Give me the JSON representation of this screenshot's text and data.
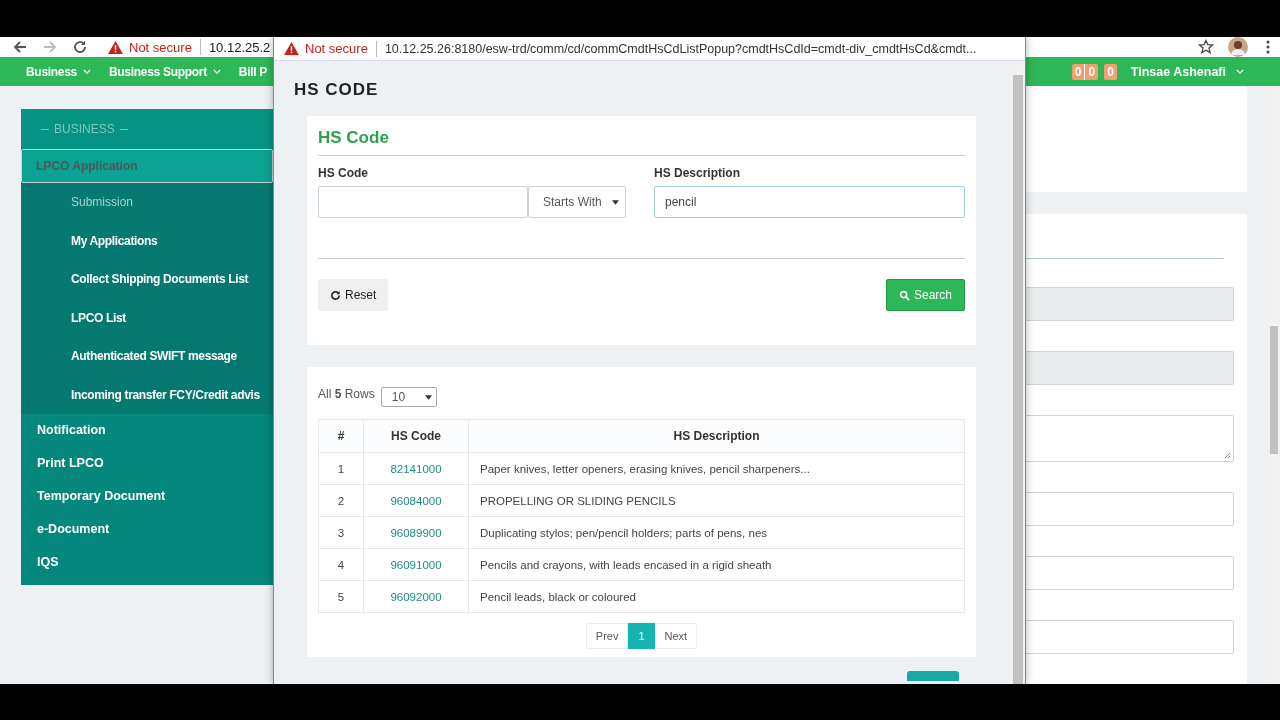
{
  "browser": {
    "security": "Not secure",
    "url": "10.12.25.2"
  },
  "nav": {
    "items": [
      {
        "label": "Business",
        "dropdown": true
      },
      {
        "label": "Business Support",
        "dropdown": true
      },
      {
        "label": "Bill P",
        "dropdown": false
      }
    ],
    "badge_groups": [
      {
        "counts": [
          "0",
          "0"
        ]
      },
      {
        "counts": [
          "0"
        ]
      }
    ],
    "user": "Tinsae Ashenafi"
  },
  "sidebar": {
    "section": "BUSINESS",
    "items": [
      {
        "label": "LPCO Application",
        "selected": true,
        "expanded": true,
        "children": [
          {
            "label": "Submission",
            "selected": true
          },
          {
            "label": "My Applications",
            "selected": false
          },
          {
            "label": "Collect Shipping Documents List",
            "selected": false
          },
          {
            "label": "LPCO List",
            "selected": false
          },
          {
            "label": "Authenticated SWIFT message",
            "selected": false
          },
          {
            "label": "Incoming transfer FCY/Credit advis",
            "selected": false
          }
        ]
      },
      {
        "label": "Notification",
        "selected": false
      },
      {
        "label": "Print LPCO",
        "selected": false
      },
      {
        "label": "Temporary Document",
        "selected": false
      },
      {
        "label": "e-Document",
        "selected": false
      },
      {
        "label": "IQS",
        "selected": false
      }
    ]
  },
  "background_form": {
    "fields": [
      {
        "kind": "input",
        "disabled": true
      },
      {
        "kind": "input",
        "disabled": true
      },
      {
        "kind": "textarea",
        "disabled": false
      },
      {
        "kind": "input",
        "disabled": false
      },
      {
        "kind": "input",
        "disabled": false
      },
      {
        "kind": "input",
        "disabled": false
      }
    ]
  },
  "popup": {
    "security": "Not secure",
    "url": "10.12.25.26:8180/esw-trd/comm/cd/commCmdtHsCdListPopup?cmdtHsCdId=cmdt-div_cmdtHsCd&cmdt...",
    "title": "HS CODE",
    "search": {
      "title": "HS Code",
      "hs_code": {
        "label": "HS Code"
      },
      "match": "Starts With",
      "hs_description": {
        "label": "HS Description",
        "value": "pencil"
      },
      "reset": "Reset",
      "submit": "Search"
    },
    "results": {
      "summary": "All **5** Rows",
      "page_size": "10",
      "columns": [
        "#",
        "HS Code",
        "HS Description"
      ],
      "rows": [
        [
          "1",
          "82141000",
          "Paper knives, letter openers, erasing knives, pencil sharpeners..."
        ],
        [
          "2",
          "96084000",
          "PROPELLING OR SLIDING PENCILS"
        ],
        [
          "3",
          "96089900",
          "Duplicating stylos; pen/pencil holders; parts of pens, nes"
        ],
        [
          "4",
          "96091000",
          "Pencils and crayons, with leads encased in a rigid sheath"
        ],
        [
          "5",
          "96092000",
          "Pencil leads, black or coloured"
        ]
      ],
      "pagination": {
        "prev": "Prev",
        "pages": [
          {
            "label": "1",
            "selected": true
          }
        ],
        "next": "Next"
      }
    }
  }
}
